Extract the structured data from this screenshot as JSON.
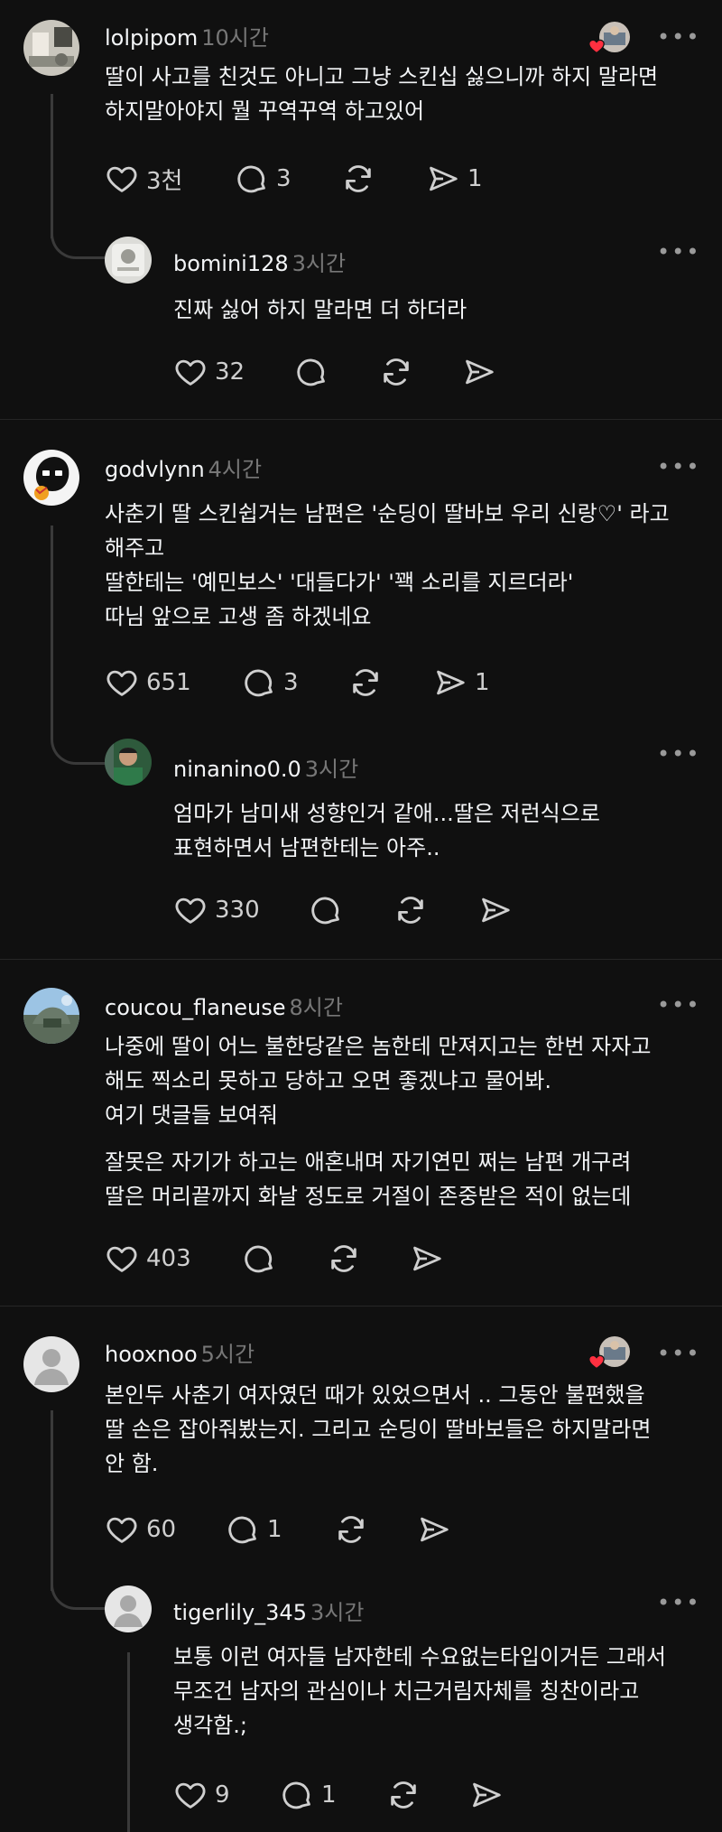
{
  "posts": [
    {
      "username": "lolpipom",
      "time": "10시간",
      "body": "딸이 사고를 친것도 아니고 그냥 스킨십 싫으니까 하지 말라면\n하지말아야지 뭘 꾸역꾸역 하고있어",
      "likes": "3천",
      "comments": "3",
      "shares": "1",
      "reply": {
        "username": "bomini128",
        "time": "3시간",
        "body": "진짜 싫어 하지 말라면 더 하더라",
        "likes": "32"
      }
    },
    {
      "username": "godvlynn",
      "time": "4시간",
      "body": "사춘기 딸 스킨쉽거는 남편은 '순딩이 딸바보 우리 신랑♡' 라고\n해주고\n딸한테는 '예민보스' '대들다가' '꽥 소리를 지르더라'\n따님 앞으로 고생 좀 하겠네요",
      "likes": "651",
      "comments": "3",
      "shares": "1",
      "reply": {
        "username": "ninanino0.0",
        "time": "3시간",
        "body": "엄마가 남미새 성향인거 같애...딸은 저런식으로\n표현하면서 남편한테는 아주..",
        "likes": "330"
      }
    },
    {
      "username": "coucou_flaneuse",
      "time": "8시간",
      "body": "나중에 딸이 어느 불한당같은 놈한테 만져지고는 한번 자자고\n해도 찍소리 못하고 당하고 오면 좋겠냐고 물어봐.\n여기 댓글들 보여줘",
      "body2": "잘못은 자기가 하고는 애혼내며 자기연민 쩌는 남편 개구려\n딸은 머리끝까지 화날 정도로 거절이 존중받은 적이 없는데",
      "likes": "403"
    },
    {
      "username": "hooxnoo",
      "time": "5시간",
      "body": "본인두 사춘기 여자였던 때가 있었으면서 .. 그동안 불편했을\n딸 손은 잡아줘봤는지. 그리고 순딩이 딸바보들은 하지말라면\n안 함.",
      "likes": "60",
      "comments": "1",
      "reply": {
        "username": "tigerlily_345",
        "time": "3시간",
        "body": "보통 이런 여자들 남자한테 수요없는타입이거든 그래서\n무조건 남자의 관심이나 치근거림자체를 칭찬이라고\n생각함.;",
        "likes": "9",
        "comments": "1"
      }
    }
  ],
  "more_glyph": "•••"
}
